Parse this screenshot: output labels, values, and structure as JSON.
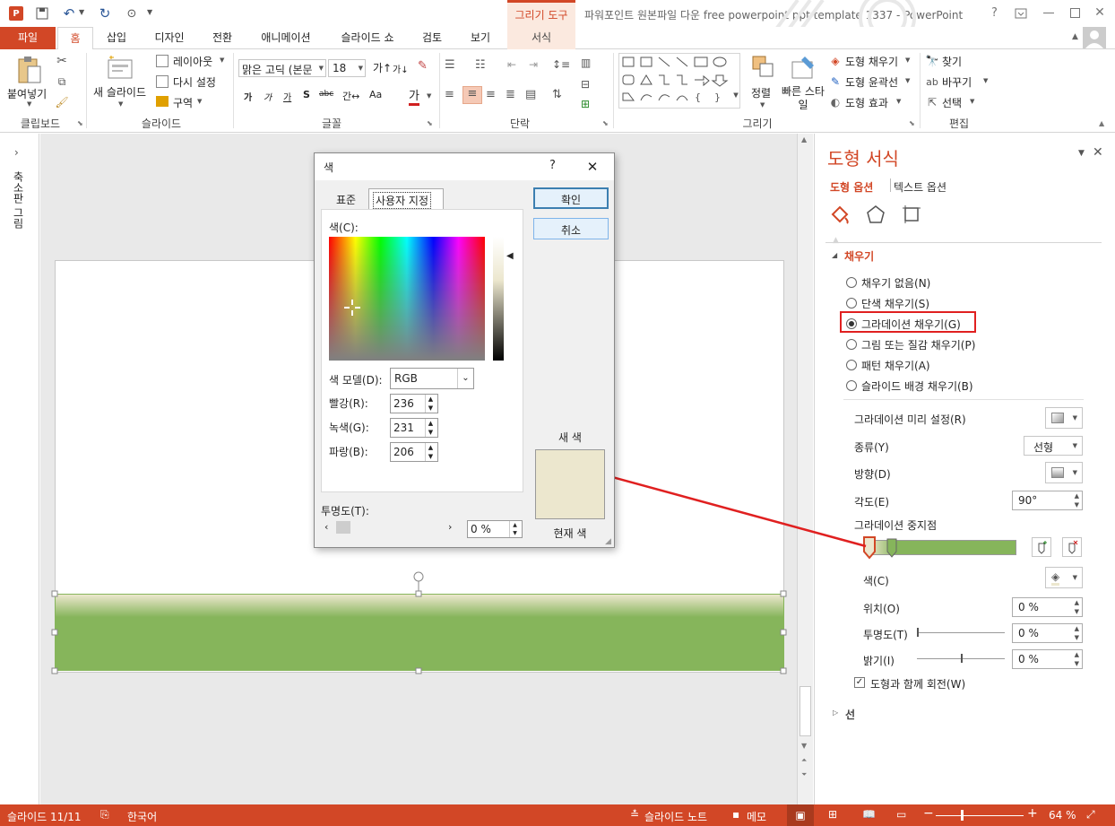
{
  "titlebar": {
    "contextual_tab": "그리기 도구",
    "doc_title": "파워포인트 원본파일 다운 free powerpoint ppt template 1337 - PowerPoint",
    "help": "?"
  },
  "tabs": [
    {
      "label": "파일"
    },
    {
      "label": "홈"
    },
    {
      "label": "삽입"
    },
    {
      "label": "디자인"
    },
    {
      "label": "전환"
    },
    {
      "label": "애니메이션"
    },
    {
      "label": "슬라이드 쇼"
    },
    {
      "label": "검토"
    },
    {
      "label": "보기"
    },
    {
      "label": "서식"
    }
  ],
  "ribbon": {
    "clipboard": {
      "paste": "붙여넣기",
      "label": "클립보드"
    },
    "slides": {
      "new_slide": "새 슬라이드",
      "layout": "레이아웃",
      "reset": "다시 설정",
      "section": "구역",
      "label": "슬라이드"
    },
    "font": {
      "font_name": "맑은 고딕 (본문",
      "font_size": "18",
      "label": "글꼴"
    },
    "paragraph": {
      "label": "단락"
    },
    "drawing": {
      "arrange": "정렬",
      "quick_styles": "빠른 스타일",
      "fill": "도형 채우기",
      "outline": "도형 윤곽선",
      "effects": "도형 효과",
      "label": "그리기"
    },
    "editing": {
      "find": "찾기",
      "replace": "바꾸기",
      "select": "선택",
      "label": "편집"
    }
  },
  "left_pane": {
    "label": "축소판 그림"
  },
  "dialog": {
    "title": "색",
    "help": "?",
    "tab_standard": "표준",
    "tab_custom": "사용자 지정",
    "colors_label": "색(C):",
    "ok": "확인",
    "cancel": "취소",
    "model_label": "색 모델(D):",
    "model_value": "RGB",
    "red_label": "빨강(R):",
    "red_value": "236",
    "green_label": "녹색(G):",
    "green_value": "231",
    "blue_label": "파랑(B):",
    "blue_value": "206",
    "transparency_label": "투명도(T):",
    "transparency_value": "0 %",
    "new_label": "새 색",
    "current_label": "현재 색",
    "new_color": "#ece7ce",
    "current_color": "#ece7ce"
  },
  "format_pane": {
    "title": "도형 서식",
    "tab_shape": "도형 옵션",
    "tab_text": "텍스트 옵션",
    "section_fill": "채우기",
    "fill_options": [
      {
        "label": "채우기 없음(N)",
        "checked": false
      },
      {
        "label": "단색 채우기(S)",
        "checked": false
      },
      {
        "label": "그라데이션 채우기(G)",
        "checked": true
      },
      {
        "label": "그림 또는 질감 채우기(P)",
        "checked": false
      },
      {
        "label": "패턴 채우기(A)",
        "checked": false
      },
      {
        "label": "슬라이드 배경 채우기(B)",
        "checked": false
      }
    ],
    "preset_label": "그라데이션 미리 설정(R)",
    "type_label": "종류(Y)",
    "type_value": "선형",
    "direction_label": "방향(D)",
    "angle_label": "각도(E)",
    "angle_value": "90°",
    "stops_label": "그라데이션 중지점",
    "color_label": "색(C)",
    "position_label": "위치(O)",
    "position_value": "0 %",
    "transparency_label": "투명도(T)",
    "transparency_value": "0 %",
    "brightness_label": "밝기(I)",
    "brightness_value": "0 %",
    "rotate_label": "도형과 함께 회전(W)",
    "section_line": "선",
    "gradient_color": "#86b55b"
  },
  "status": {
    "slide": "슬라이드 11/11",
    "language": "한국어",
    "notes": "슬라이드 노트",
    "comments": "메모",
    "zoom": "64 %"
  },
  "colors": {
    "accent": "#d24726",
    "highlight": "#e02020",
    "status_bg": "#d24726"
  }
}
